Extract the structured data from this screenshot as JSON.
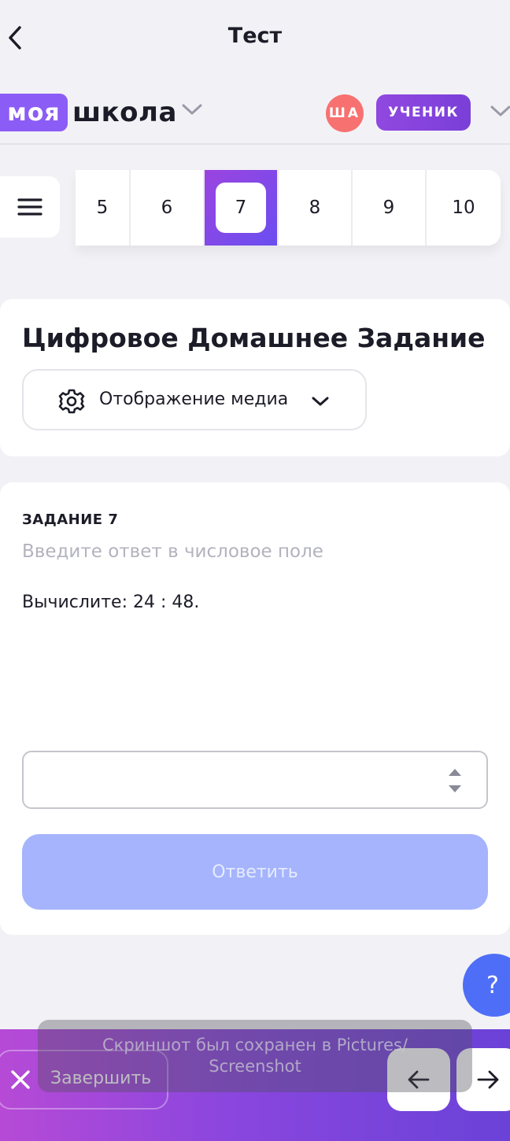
{
  "header": {
    "title": "Тест"
  },
  "brand": {
    "logo_part1": "моя",
    "logo_part2": "школа",
    "user_initials": "ША",
    "role": "УЧЕНИК",
    "accent_color": "#8b5cf6"
  },
  "task_nav": {
    "tabs": [
      "5",
      "6",
      "7",
      "8",
      "9",
      "10"
    ],
    "active": "7"
  },
  "homework": {
    "title": "Цифровое Домашнее Задание",
    "media_select_label": "Отображение медиа"
  },
  "task": {
    "label": "ЗАДАНИЕ 7",
    "hint": "Введите ответ в числовое поле",
    "text": "Вычислите: 24 : 48.",
    "answer_value": "",
    "submit_label": "Ответить"
  },
  "help": {
    "label": "?"
  },
  "footer": {
    "finish_label": "Завершить"
  },
  "toast": {
    "message": "Скриншот был сохранен в  Pictures/ Screenshot"
  },
  "icons": [
    "back-arrow-icon",
    "chevron-down-icon",
    "menu-icon",
    "gear-icon",
    "close-icon",
    "arrow-left-icon",
    "arrow-right-icon",
    "stepper-icon"
  ]
}
